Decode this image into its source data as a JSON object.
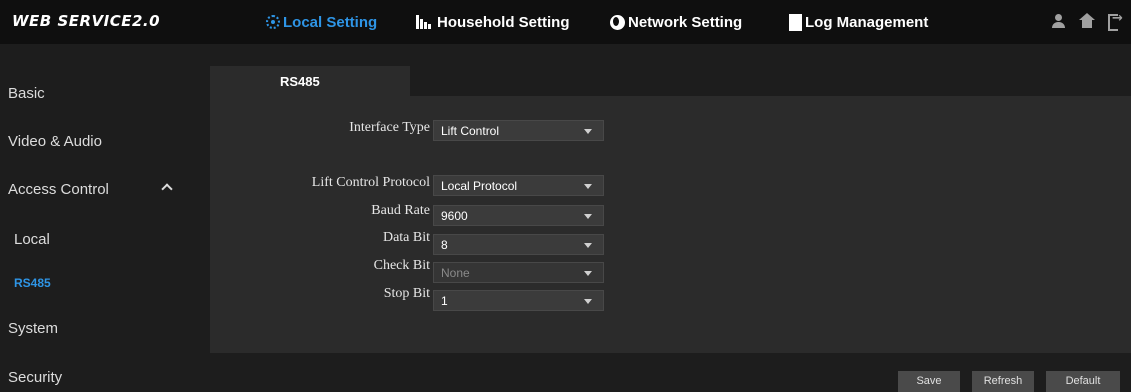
{
  "app": {
    "brand": "WEB SERVICE2.0"
  },
  "nav": [
    {
      "label": "Local Setting",
      "icon": "gear-icon",
      "active": true
    },
    {
      "label": "Household Setting",
      "icon": "household-icon"
    },
    {
      "label": "Network Setting",
      "icon": "globe-icon"
    },
    {
      "label": "Log Management",
      "icon": "log-icon"
    }
  ],
  "header_icons": [
    "user-icon",
    "home-icon",
    "logout-icon"
  ],
  "sidebar": {
    "items": [
      {
        "label": "Basic"
      },
      {
        "label": "Video & Audio"
      },
      {
        "label": "Access Control",
        "expanded": true
      },
      {
        "label": "Local"
      },
      {
        "label": "RS485",
        "active": true
      },
      {
        "label": "System"
      },
      {
        "label": "Security"
      }
    ]
  },
  "tab": {
    "label": "RS485"
  },
  "form": {
    "interface_type": {
      "label": "Interface Type",
      "value": "Lift Control"
    },
    "protocol": {
      "label": "Lift Control Protocol",
      "value": "Local Protocol"
    },
    "baud_rate": {
      "label": "Baud Rate",
      "value": "9600"
    },
    "data_bit": {
      "label": "Data Bit",
      "value": "8"
    },
    "check_bit": {
      "label": "Check Bit",
      "value": "None",
      "disabled": true
    },
    "stop_bit": {
      "label": "Stop Bit",
      "value": "1"
    }
  },
  "buttons": {
    "save": "Save",
    "refresh": "Refresh",
    "default": "Default"
  },
  "colors": {
    "accent": "#2e95e6",
    "panel": "#2b2b2b",
    "background": "#1d1d1d",
    "topbar": "#0f0f0f"
  }
}
